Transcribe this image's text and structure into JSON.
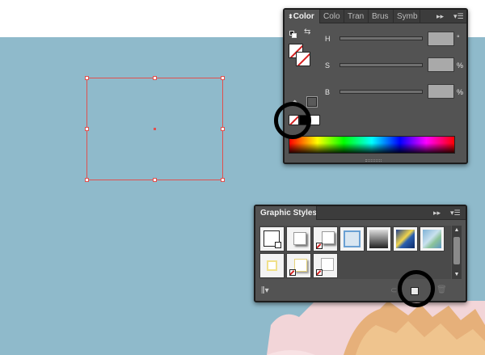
{
  "color_panel": {
    "tabs": [
      "Color",
      "Colo",
      "Tran",
      "Brus",
      "Symb"
    ],
    "sliders": [
      {
        "label": "H",
        "unit": "°"
      },
      {
        "label": "S",
        "unit": "%"
      },
      {
        "label": "B",
        "unit": "%"
      }
    ],
    "menu_icon": "panel-menu-icon",
    "expand_icon": "double-arrow-icon"
  },
  "graphic_styles_panel": {
    "tab": "Graphic Styles",
    "menu_icon": "panel-menu-icon",
    "expand_icon": "double-arrow-icon",
    "styles": [
      "default-style",
      "drop-shadow-style",
      "shadow-none-fill-style",
      "blue-frame-style",
      "gray-gradient-style",
      "starry-night-style",
      "blue-wash-style",
      "yellow-glow-style",
      "yellow-shadow-style",
      "none-fill-style"
    ],
    "bottom_icons": [
      "libraries-menu-icon",
      "break-link-icon",
      "new-graphic-style-icon",
      "delete-icon"
    ]
  },
  "colors": {
    "canvas": "#8fbacb",
    "selection": "#e0504e",
    "panel_bg": "#535353",
    "highlight": "#000000"
  }
}
